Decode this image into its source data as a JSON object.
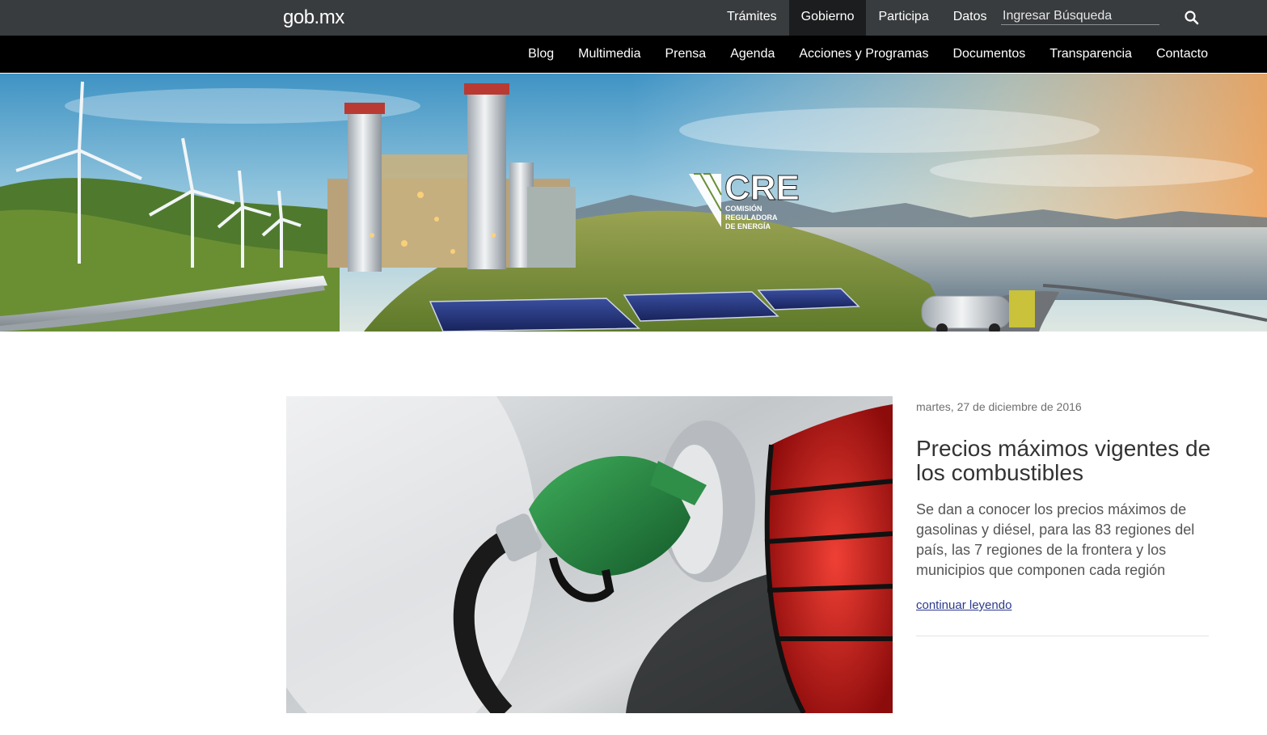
{
  "header": {
    "logo": "gob.mx",
    "top_nav": [
      {
        "label": "Trámites",
        "active": false
      },
      {
        "label": "Gobierno",
        "active": true
      },
      {
        "label": "Participa",
        "active": false
      },
      {
        "label": "Datos",
        "active": false
      }
    ],
    "search": {
      "placeholder": "Ingresar Búsqueda",
      "value": ""
    }
  },
  "subnav": [
    "Blog",
    "Multimedia",
    "Prensa",
    "Agenda",
    "Acciones y Programas",
    "Documentos",
    "Transparencia",
    "Contacto"
  ],
  "hero": {
    "logo_text": "CRE",
    "logo_sub": [
      "COMISIÓN",
      "REGULADORA",
      "DE ENERGÍA"
    ]
  },
  "article": {
    "date": "martes, 27 de diciembre de 2016",
    "title": "Precios máximos vigentes de los combustibles",
    "summary": "Se dan a conocer los precios máximos de gasolinas y diésel, para las 83 regiones del país, las 7 regiones de la frontera y los municipios que componen cada región",
    "link": "continuar leyendo"
  },
  "colors": {
    "topbar": "#393c3e",
    "topbar_active": "#1c1d1e",
    "subbar": "#000000",
    "link": "#2b3a8c"
  }
}
